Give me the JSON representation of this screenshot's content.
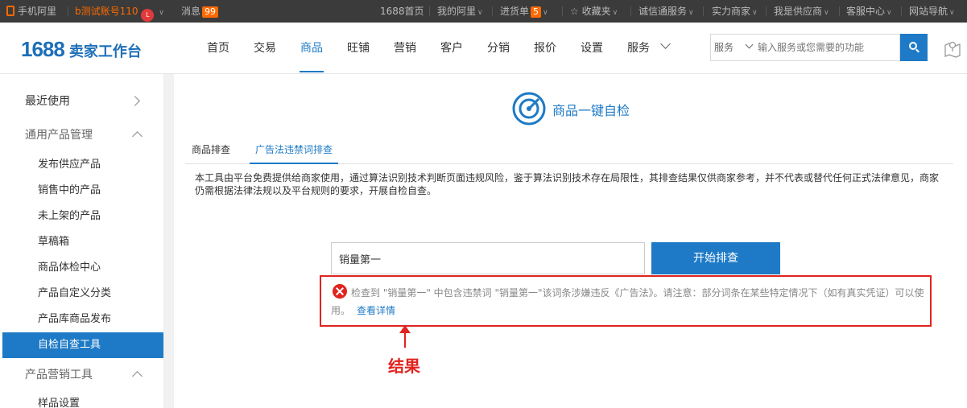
{
  "topbar": {
    "mobile_label": "手机阿里",
    "account_name": "b测试账号110",
    "avatar_text": "L",
    "message_label": "消息",
    "message_count": "99",
    "home_1688": "1688首页",
    "my_ali": "我的阿里",
    "purchase_label": "进货单",
    "purchase_count": "5",
    "favorites": "收藏夹",
    "chengxin": "诚信通服务",
    "strength_merchant": "实力商家",
    "i_am_supplier": "我是供应商",
    "service_center": "客服中心",
    "site_nav": "网站导航"
  },
  "header": {
    "logo_number": "1688",
    "logo_text": "卖家工作台",
    "nav": [
      "首页",
      "交易",
      "商品",
      "旺铺",
      "营销",
      "客户",
      "分销",
      "报价",
      "设置",
      "服务"
    ],
    "active_nav": "商品",
    "search": {
      "category": "服务",
      "placeholder": "输入服务或您需要的功能"
    }
  },
  "sidebar": {
    "recent": "最近使用",
    "group1": "通用产品管理",
    "items": [
      "发布供应产品",
      "销售中的产品",
      "未上架的产品",
      "草稿箱",
      "商品体检中心",
      "产品自定义分类",
      "产品库商品发布",
      "自检自查工具"
    ],
    "active_item": "自检自查工具",
    "group2": "产品营销工具",
    "group2_items": [
      "样品设置"
    ]
  },
  "main": {
    "title": "商品一键自检",
    "tabs": [
      "商品排查",
      "广告法违禁词排查"
    ],
    "active_tab": "广告法违禁词排查",
    "description": "本工具由平台免费提供给商家使用，通过算法识别技术判断页面违规风险，鉴于算法识别技术存在局限性，其排查结果仅供商家参考，并不代表或替代任何正式法律意见，商家仍需根据法律法规以及平台规则的要求，开展自检自查。",
    "keyword_value": "销量第一",
    "start_button": "开始排查",
    "result_text": "检查到 \"销量第一\" 中包含违禁词 \"销量第一\"该词条涉嫌违反《广告法》。请注意：部分词条在某些特定情况下（如有真实凭证）可以使用。",
    "detail_link": "查看详情",
    "annotation": "结果",
    "colors": {
      "accent": "#1e7ac6",
      "error": "#e0241f",
      "brand_orange": "#ff6a00"
    }
  }
}
